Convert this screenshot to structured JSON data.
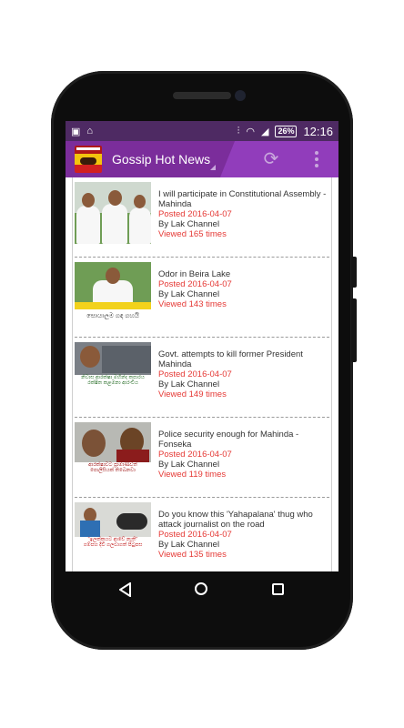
{
  "status_bar": {
    "battery": "26%",
    "time": "12:16"
  },
  "app_bar": {
    "title": "Gossip Hot News"
  },
  "news": [
    {
      "title": "I will participate in Constitutional Assembly - Mahinda",
      "posted": "Posted 2016-04-07",
      "author": "By Lak Channel",
      "views": "Viewed 165 times"
    },
    {
      "title": "Odor in Beira Lake",
      "posted": "Posted 2016-04-07",
      "author": "By Lak Channel",
      "views": "Viewed 143 times"
    },
    {
      "title": "Govt. attempts to kill former President Mahinda",
      "posted": "Posted 2016-04-07",
      "author": "By Lak Channel",
      "views": "Viewed 149 times"
    },
    {
      "title": "Police security enough for Mahinda - Fonseka",
      "posted": "Posted 2016-04-07",
      "author": "By Lak Channel",
      "views": "Viewed 119 times"
    },
    {
      "title": "Do you know this 'Yahapalana' thug who attack journalist on the road",
      "posted": "Posted 2016-04-07",
      "author": "By Lak Channel",
      "views": "Viewed 135 times"
    }
  ],
  "icons": {
    "app_logo": "app-logo",
    "refresh": "refresh-icon",
    "overflow": "more-vert-icon",
    "back": "back-icon",
    "home": "home-icon",
    "recent": "recent-apps-icon"
  },
  "colors": {
    "status_bar": "#4e2a63",
    "app_bar": "#7b2d9b",
    "posted_text": "#e53935",
    "views_text": "#e53935"
  }
}
